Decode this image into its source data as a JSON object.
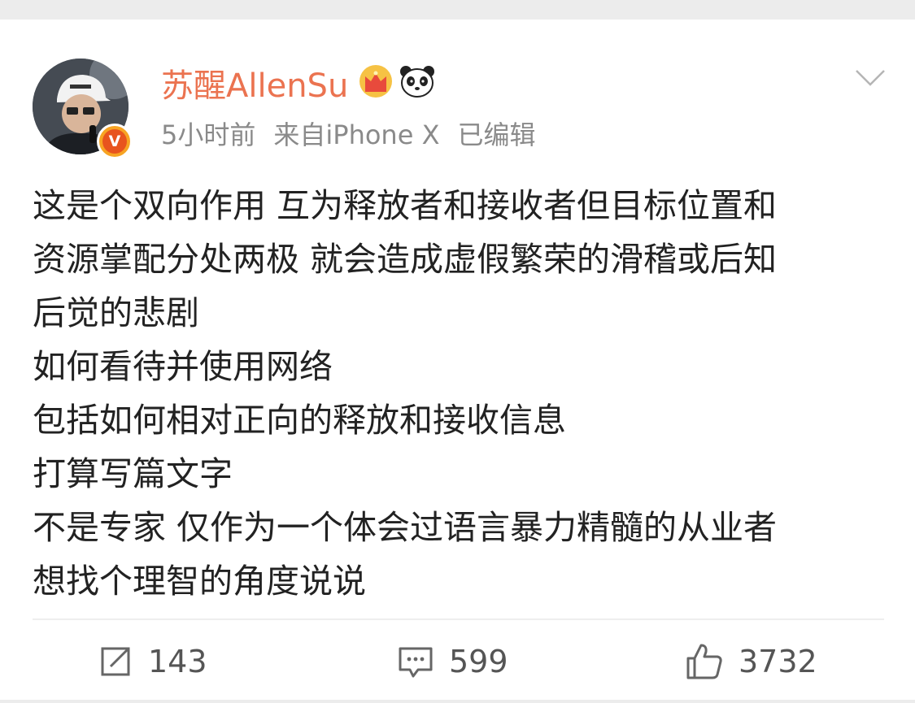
{
  "post": {
    "author": {
      "name": "苏醒AllenSu",
      "avatar_icon": "user-avatar",
      "verified_icon": "verified-v-icon",
      "verified_label": "V",
      "badges": [
        "crown-icon",
        "panda-icon"
      ]
    },
    "meta": {
      "time": "5小时前",
      "source": "来自iPhone X",
      "edited": "已编辑"
    },
    "menu_icon": "chevron-down-icon",
    "content_lines": [
      "这是个双向作用 互为释放者和接收者但目标位置和",
      "资源掌配分处两极 就会造成虚假繁荣的滑稽或后知",
      "后觉的悲剧",
      "如何看待并使用网络",
      "包括如何相对正向的释放和接收信息",
      "打算写篇文字",
      "不是专家 仅作为一个体会过语言暴力精髓的从业者",
      "想找个理智的角度说说"
    ]
  },
  "actions": {
    "repost": {
      "icon": "repost-icon",
      "count": "143"
    },
    "comment": {
      "icon": "comment-icon",
      "count": "599"
    },
    "like": {
      "icon": "like-thumb-icon",
      "count": "3732"
    }
  },
  "colors": {
    "username": "#eb7350",
    "meta": "#8a8a8a",
    "text": "#222222",
    "verified_outer": "#f7a423",
    "verified_inner": "#e8541e"
  }
}
